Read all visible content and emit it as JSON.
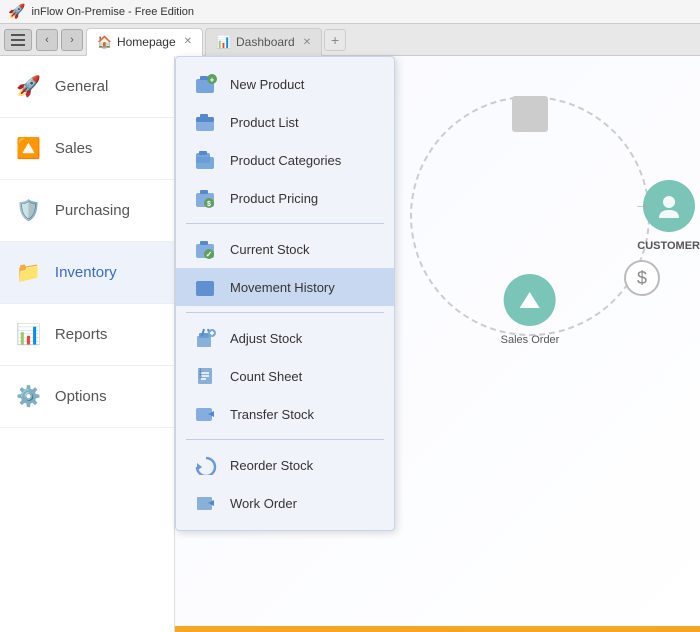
{
  "app": {
    "title": "inFlow On-Premise - Free Edition",
    "icon": "🚀"
  },
  "tabs": [
    {
      "id": "homepage",
      "label": "Homepage",
      "icon": "🏠",
      "active": true
    },
    {
      "id": "dashboard",
      "label": "Dashboard",
      "icon": "📊",
      "active": false
    }
  ],
  "nav": {
    "back": "‹",
    "forward": "›",
    "add": "+"
  },
  "sidebar": {
    "items": [
      {
        "id": "general",
        "label": "General",
        "icon": "rocket",
        "active": false
      },
      {
        "id": "sales",
        "label": "Sales",
        "icon": "sales",
        "active": false
      },
      {
        "id": "purchasing",
        "label": "Purchasing",
        "icon": "purchasing",
        "active": false
      },
      {
        "id": "inventory",
        "label": "Inventory",
        "icon": "inventory",
        "active": true
      },
      {
        "id": "reports",
        "label": "Reports",
        "icon": "reports",
        "active": false
      },
      {
        "id": "options",
        "label": "Options",
        "icon": "options",
        "active": false
      }
    ]
  },
  "dropdown": {
    "items": [
      {
        "id": "new-product",
        "label": "New Product",
        "icon": "folder-add",
        "section": 1
      },
      {
        "id": "product-list",
        "label": "Product List",
        "icon": "folder",
        "section": 1
      },
      {
        "id": "product-categories",
        "label": "Product Categories",
        "icon": "folder-stack",
        "section": 1
      },
      {
        "id": "product-pricing",
        "label": "Product Pricing",
        "icon": "folder-dollar",
        "section": 1
      },
      {
        "id": "current-stock",
        "label": "Current Stock",
        "icon": "folder-check",
        "section": 2
      },
      {
        "id": "movement-history",
        "label": "Movement History",
        "icon": "folder-blue",
        "section": 2,
        "selected": true
      },
      {
        "id": "adjust-stock",
        "label": "Adjust Stock",
        "icon": "wrench",
        "section": 3
      },
      {
        "id": "count-sheet",
        "label": "Count Sheet",
        "icon": "list",
        "section": 3
      },
      {
        "id": "transfer-stock",
        "label": "Transfer Stock",
        "icon": "transfer",
        "section": 3
      },
      {
        "id": "reorder-stock",
        "label": "Reorder Stock",
        "icon": "reorder",
        "section": 4
      },
      {
        "id": "work-order",
        "label": "Work Order",
        "icon": "work",
        "section": 4
      }
    ]
  },
  "diagram": {
    "sales_order_label": "Sales Order",
    "customer_label": "CUSTOMER"
  }
}
